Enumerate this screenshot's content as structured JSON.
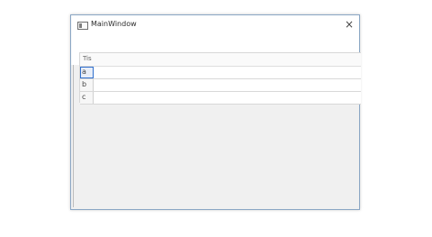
{
  "window": {
    "title": "MainWindow",
    "close_icon": "close-icon"
  },
  "table": {
    "column_header": "Tis",
    "rows": [
      {
        "label": "a"
      },
      {
        "label": "b"
      },
      {
        "label": "c"
      }
    ]
  }
}
